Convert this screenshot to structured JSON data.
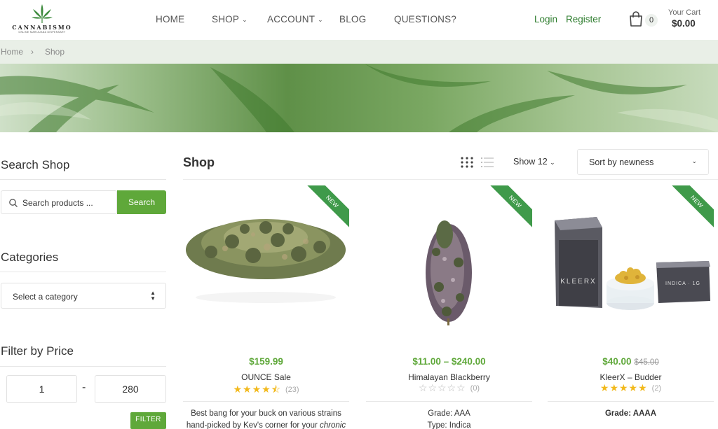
{
  "brand": {
    "name": "CANNABISMO",
    "tagline": "ONLINE MARIJUANA DISPENSARY"
  },
  "nav": {
    "items": [
      {
        "label": "HOME",
        "has_dropdown": false
      },
      {
        "label": "SHOP",
        "has_dropdown": true
      },
      {
        "label": "ACCOUNT",
        "has_dropdown": true
      },
      {
        "label": "BLOG",
        "has_dropdown": false
      },
      {
        "label": "QUESTIONS?",
        "has_dropdown": false
      }
    ]
  },
  "auth": {
    "login": "Login",
    "register": "Register"
  },
  "cart": {
    "count": "0",
    "label": "Your Cart",
    "total": "$0.00"
  },
  "breadcrumb": {
    "home": "Home",
    "separator": "›",
    "current": "Shop"
  },
  "sidebar": {
    "search_title": "Search Shop",
    "search_placeholder": "Search products ...",
    "search_button": "Search",
    "categories_title": "Categories",
    "category_selected": "Select a category",
    "price_title": "Filter by Price",
    "price_min": "1",
    "price_separator": "-",
    "price_max": "280",
    "filter_button": "FILTER"
  },
  "shop": {
    "title": "Shop",
    "show_label": "Show 12",
    "sort_label": "Sort by newness"
  },
  "products": [
    {
      "badge": "NEW",
      "price": "$159.99",
      "old_price": "",
      "name": "OUNCE Sale",
      "rating": 4.5,
      "review_count": "(23)",
      "desc_line1": "Best bang for your buck on various strains",
      "desc_line2_prefix": "hand-picked by Kev's corner for your ",
      "desc_line2_em": "chronic"
    },
    {
      "badge": "NEW",
      "price": "$11.00 – $240.00",
      "old_price": "",
      "name": "Himalayan Blackberry",
      "rating": 0,
      "review_count": "(0)",
      "desc_line1": "Grade: AAA",
      "desc_line2": "Type: Indica"
    },
    {
      "badge": "NEW",
      "price": "$40.00",
      "old_price": "$45.00",
      "name": "KleerX – Budder",
      "rating": 5,
      "review_count": "(2)",
      "desc_line1": "Grade: AAAA",
      "product_label_jar": "KLEERX",
      "product_label_box": "INDICA · 1G"
    }
  ],
  "colors": {
    "accent": "#5fa83a",
    "brand_green": "#2e7d2e",
    "ribbon": "#3f9a4a",
    "star": "#f2b91c",
    "breadcrumb_bg": "#e9efe7"
  }
}
